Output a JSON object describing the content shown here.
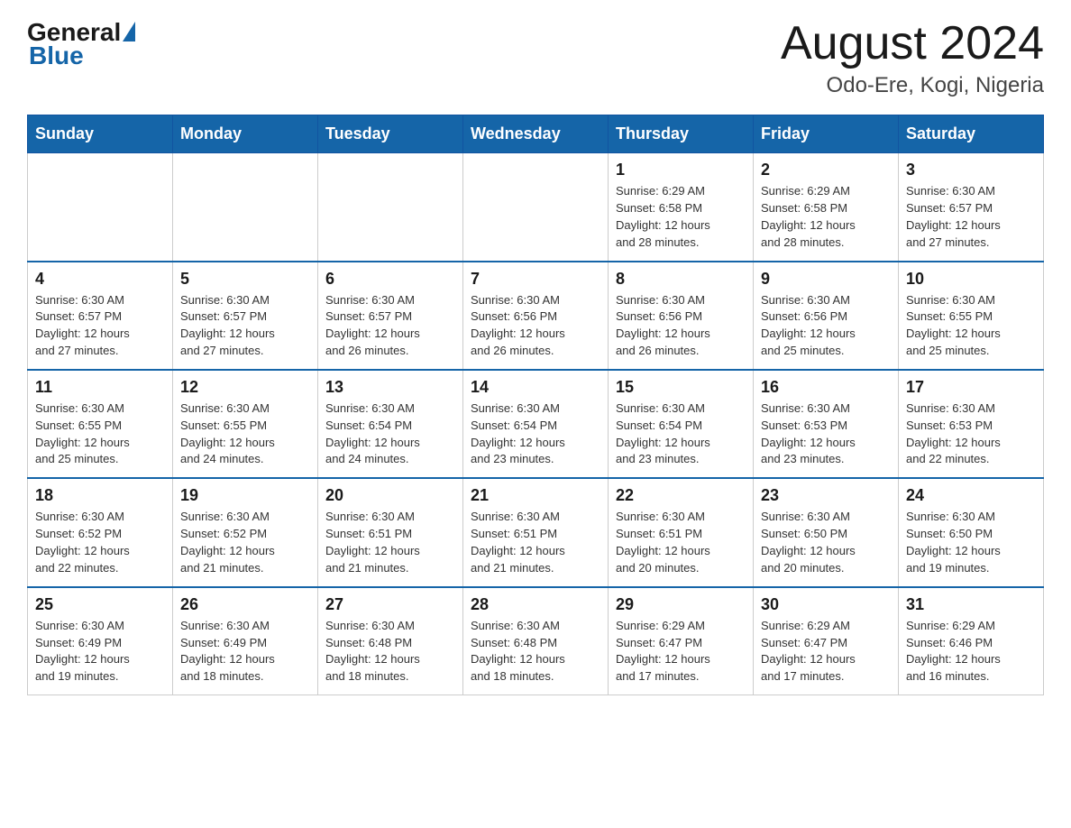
{
  "header": {
    "logo_general": "General",
    "logo_blue": "Blue",
    "title": "August 2024",
    "subtitle": "Odo-Ere, Kogi, Nigeria"
  },
  "days_of_week": [
    "Sunday",
    "Monday",
    "Tuesday",
    "Wednesday",
    "Thursday",
    "Friday",
    "Saturday"
  ],
  "weeks": [
    [
      {
        "day": "",
        "info": ""
      },
      {
        "day": "",
        "info": ""
      },
      {
        "day": "",
        "info": ""
      },
      {
        "day": "",
        "info": ""
      },
      {
        "day": "1",
        "info": "Sunrise: 6:29 AM\nSunset: 6:58 PM\nDaylight: 12 hours\nand 28 minutes."
      },
      {
        "day": "2",
        "info": "Sunrise: 6:29 AM\nSunset: 6:58 PM\nDaylight: 12 hours\nand 28 minutes."
      },
      {
        "day": "3",
        "info": "Sunrise: 6:30 AM\nSunset: 6:57 PM\nDaylight: 12 hours\nand 27 minutes."
      }
    ],
    [
      {
        "day": "4",
        "info": "Sunrise: 6:30 AM\nSunset: 6:57 PM\nDaylight: 12 hours\nand 27 minutes."
      },
      {
        "day": "5",
        "info": "Sunrise: 6:30 AM\nSunset: 6:57 PM\nDaylight: 12 hours\nand 27 minutes."
      },
      {
        "day": "6",
        "info": "Sunrise: 6:30 AM\nSunset: 6:57 PM\nDaylight: 12 hours\nand 26 minutes."
      },
      {
        "day": "7",
        "info": "Sunrise: 6:30 AM\nSunset: 6:56 PM\nDaylight: 12 hours\nand 26 minutes."
      },
      {
        "day": "8",
        "info": "Sunrise: 6:30 AM\nSunset: 6:56 PM\nDaylight: 12 hours\nand 26 minutes."
      },
      {
        "day": "9",
        "info": "Sunrise: 6:30 AM\nSunset: 6:56 PM\nDaylight: 12 hours\nand 25 minutes."
      },
      {
        "day": "10",
        "info": "Sunrise: 6:30 AM\nSunset: 6:55 PM\nDaylight: 12 hours\nand 25 minutes."
      }
    ],
    [
      {
        "day": "11",
        "info": "Sunrise: 6:30 AM\nSunset: 6:55 PM\nDaylight: 12 hours\nand 25 minutes."
      },
      {
        "day": "12",
        "info": "Sunrise: 6:30 AM\nSunset: 6:55 PM\nDaylight: 12 hours\nand 24 minutes."
      },
      {
        "day": "13",
        "info": "Sunrise: 6:30 AM\nSunset: 6:54 PM\nDaylight: 12 hours\nand 24 minutes."
      },
      {
        "day": "14",
        "info": "Sunrise: 6:30 AM\nSunset: 6:54 PM\nDaylight: 12 hours\nand 23 minutes."
      },
      {
        "day": "15",
        "info": "Sunrise: 6:30 AM\nSunset: 6:54 PM\nDaylight: 12 hours\nand 23 minutes."
      },
      {
        "day": "16",
        "info": "Sunrise: 6:30 AM\nSunset: 6:53 PM\nDaylight: 12 hours\nand 23 minutes."
      },
      {
        "day": "17",
        "info": "Sunrise: 6:30 AM\nSunset: 6:53 PM\nDaylight: 12 hours\nand 22 minutes."
      }
    ],
    [
      {
        "day": "18",
        "info": "Sunrise: 6:30 AM\nSunset: 6:52 PM\nDaylight: 12 hours\nand 22 minutes."
      },
      {
        "day": "19",
        "info": "Sunrise: 6:30 AM\nSunset: 6:52 PM\nDaylight: 12 hours\nand 21 minutes."
      },
      {
        "day": "20",
        "info": "Sunrise: 6:30 AM\nSunset: 6:51 PM\nDaylight: 12 hours\nand 21 minutes."
      },
      {
        "day": "21",
        "info": "Sunrise: 6:30 AM\nSunset: 6:51 PM\nDaylight: 12 hours\nand 21 minutes."
      },
      {
        "day": "22",
        "info": "Sunrise: 6:30 AM\nSunset: 6:51 PM\nDaylight: 12 hours\nand 20 minutes."
      },
      {
        "day": "23",
        "info": "Sunrise: 6:30 AM\nSunset: 6:50 PM\nDaylight: 12 hours\nand 20 minutes."
      },
      {
        "day": "24",
        "info": "Sunrise: 6:30 AM\nSunset: 6:50 PM\nDaylight: 12 hours\nand 19 minutes."
      }
    ],
    [
      {
        "day": "25",
        "info": "Sunrise: 6:30 AM\nSunset: 6:49 PM\nDaylight: 12 hours\nand 19 minutes."
      },
      {
        "day": "26",
        "info": "Sunrise: 6:30 AM\nSunset: 6:49 PM\nDaylight: 12 hours\nand 18 minutes."
      },
      {
        "day": "27",
        "info": "Sunrise: 6:30 AM\nSunset: 6:48 PM\nDaylight: 12 hours\nand 18 minutes."
      },
      {
        "day": "28",
        "info": "Sunrise: 6:30 AM\nSunset: 6:48 PM\nDaylight: 12 hours\nand 18 minutes."
      },
      {
        "day": "29",
        "info": "Sunrise: 6:29 AM\nSunset: 6:47 PM\nDaylight: 12 hours\nand 17 minutes."
      },
      {
        "day": "30",
        "info": "Sunrise: 6:29 AM\nSunset: 6:47 PM\nDaylight: 12 hours\nand 17 minutes."
      },
      {
        "day": "31",
        "info": "Sunrise: 6:29 AM\nSunset: 6:46 PM\nDaylight: 12 hours\nand 16 minutes."
      }
    ]
  ]
}
